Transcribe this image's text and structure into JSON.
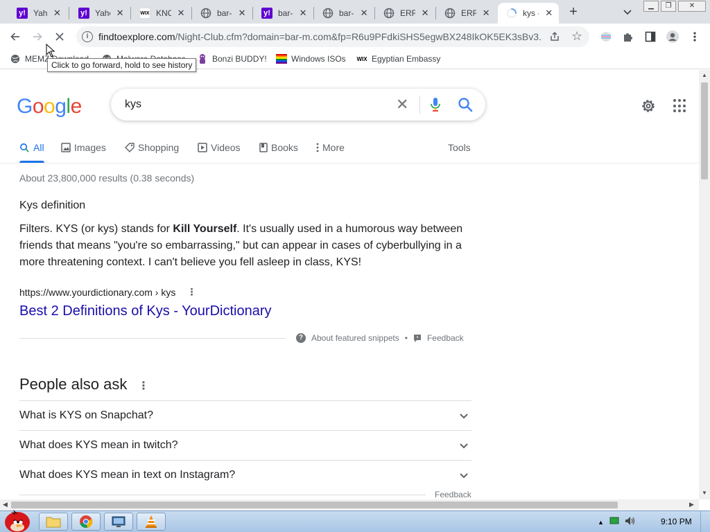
{
  "browser": {
    "tabs": [
      {
        "title": "Yahoo",
        "favicon": "yahoo",
        "active": false
      },
      {
        "title": "Yahoo",
        "favicon": "yahoo",
        "active": false
      },
      {
        "title": "KNOW",
        "favicon": "wix",
        "active": false
      },
      {
        "title": "bar-m",
        "favicon": "globe",
        "active": false
      },
      {
        "title": "bar-m",
        "favicon": "yahoo",
        "active": false
      },
      {
        "title": "bar-m",
        "favicon": "globe",
        "active": false
      },
      {
        "title": "ERROR",
        "favicon": "globe",
        "active": false
      },
      {
        "title": "ERROR",
        "favicon": "globe",
        "active": false
      },
      {
        "title": "kys -",
        "favicon": "loading",
        "active": true
      }
    ],
    "url_host": "findtoexplore.com",
    "url_path": "/Night-Club.cfm?domain=bar-m.com&fp=R6u9PFdkiSHS5egwBX248IkOK5EK3sBv3...",
    "tooltip": "Click to go forward, hold to see history",
    "bookmarks": [
      {
        "label": "MEMZ Download",
        "icon": "globe-icon"
      },
      {
        "label": "Malware Database",
        "icon": "globe-icon"
      },
      {
        "label": "Bonzi BUDDY!",
        "icon": "bonzi-icon"
      },
      {
        "label": "Windows ISOs",
        "icon": "rainbow-flag-icon"
      },
      {
        "label": "Egyptian Embassy",
        "icon": "wix-icon"
      }
    ]
  },
  "search": {
    "logo": "Google",
    "query": "kys",
    "tabs": [
      "All",
      "Images",
      "Shopping",
      "Videos",
      "Books",
      "More"
    ],
    "tools_label": "Tools",
    "stats": "About 23,800,000 results (0.38 seconds)"
  },
  "snippet": {
    "title": "Kys definition",
    "text_before": "Filters. KYS (or kys) stands for ",
    "text_bold": "Kill Yourself",
    "text_after": ". It's usually used in a humorous way between friends that means \"you're so embarrassing,\" but can appear in cases of cyberbullying in a more threatening context. I can't believe you fell asleep in class, KYS!",
    "cite": "https://www.yourdictionary.com › kys",
    "link": "Best 2 Definitions of Kys - YourDictionary",
    "about": "About featured snippets",
    "bullet": "•",
    "feedback": "Feedback"
  },
  "people_also_ask": {
    "title": "People also ask",
    "questions": [
      "What is KYS on Snapchat?",
      "What does KYS mean in twitch?",
      "What does KYS mean in text on Instagram?"
    ],
    "feedback": "Feedback"
  },
  "taskbar": {
    "clock": "9:10 PM"
  },
  "colors": {
    "link": "#1a0dab",
    "accent": "#1a73e8",
    "yahoo": "#5f01d1"
  }
}
